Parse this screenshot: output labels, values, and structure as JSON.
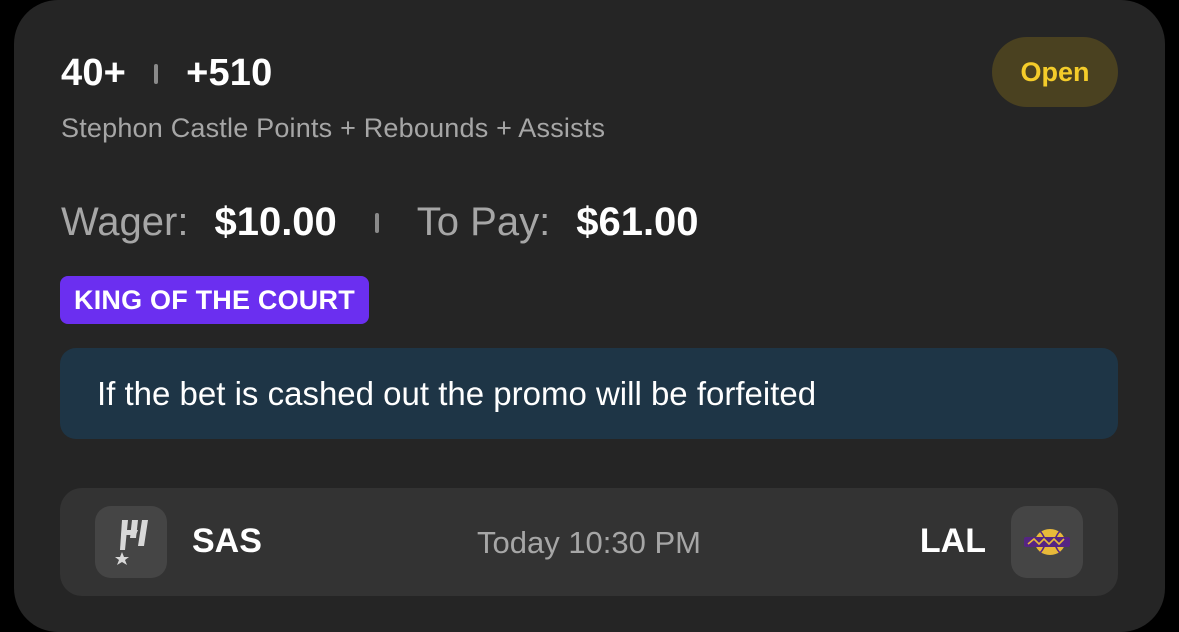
{
  "bet": {
    "line": "40+",
    "odds": "+510",
    "status": "Open",
    "market": "Stephon Castle Points + Rebounds + Assists"
  },
  "amounts": {
    "wager_label": "Wager:",
    "wager_value": "$10.00",
    "payout_label": "To Pay:",
    "payout_value": "$61.00"
  },
  "promo": {
    "tag": "KING OF THE COURT",
    "notice": "If the bet is cashed out the promo will be forfeited"
  },
  "game": {
    "home_team": "SAS",
    "home_logo_icon": "spurs-logo-icon",
    "away_team": "LAL",
    "away_logo_icon": "lakers-logo-icon",
    "time": "Today 10:30 PM"
  },
  "colors": {
    "card_bg": "#252525",
    "status_open_text": "#f4cc2a",
    "status_open_bg": "#4a4120",
    "promo_tag_bg": "#6b2ff0",
    "notice_bg": "#1e3546",
    "game_row_bg": "#333333"
  }
}
